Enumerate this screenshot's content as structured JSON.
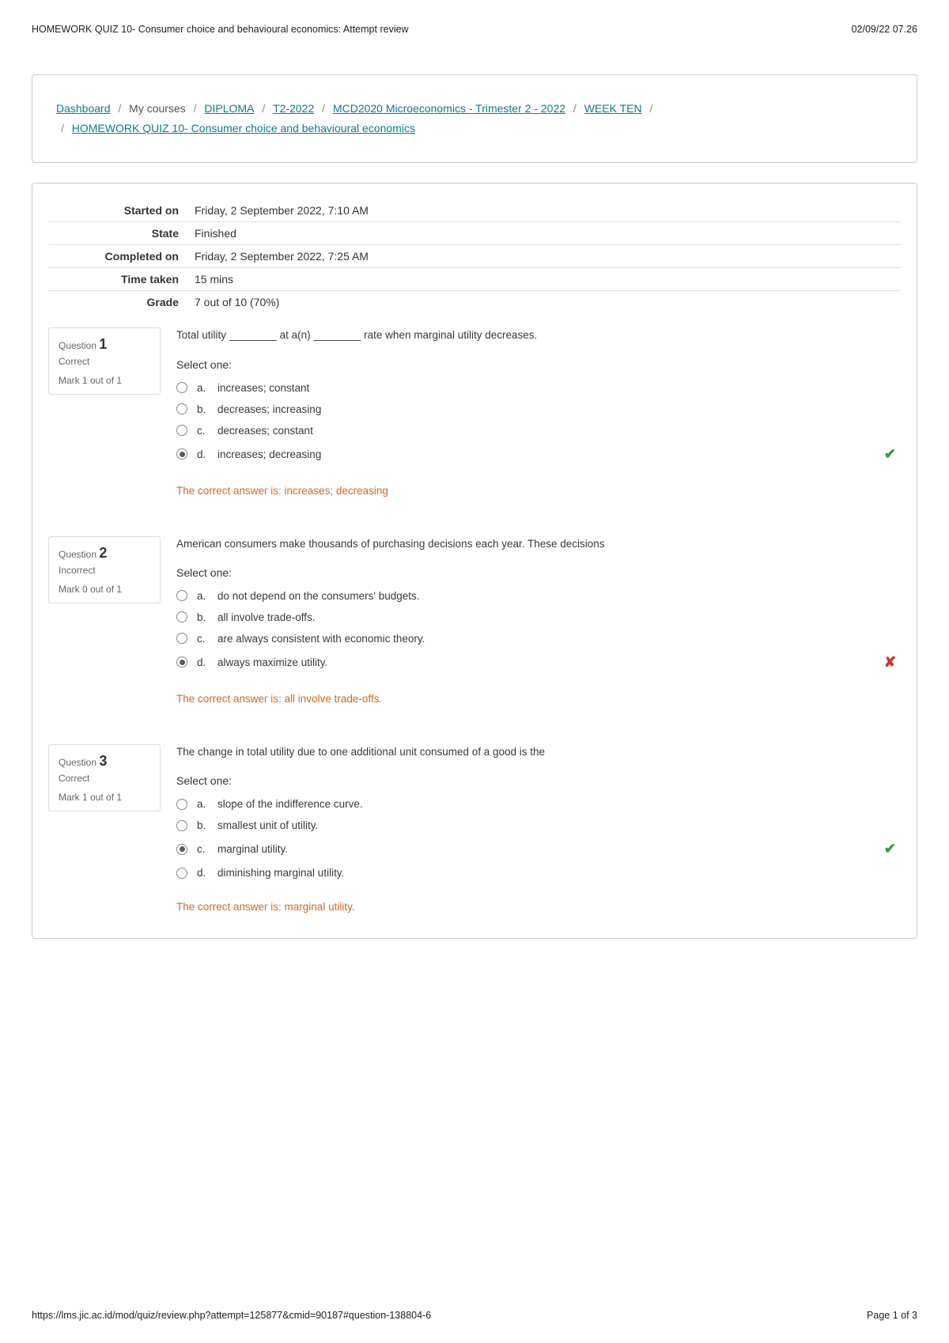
{
  "header": {
    "title": "HOMEWORK QUIZ 10- Consumer choice and behavioural economics: Attempt review",
    "datetime": "02/09/22 07.26"
  },
  "breadcrumb": {
    "items": [
      {
        "label": "Dashboard",
        "link": true
      },
      {
        "label": "My courses",
        "link": false
      },
      {
        "label": "DIPLOMA",
        "link": true
      },
      {
        "label": "T2-2022",
        "link": true
      },
      {
        "label": "MCD2020 Microeconomics - Trimester 2 - 2022",
        "link": true
      },
      {
        "label": "WEEK TEN",
        "link": true
      },
      {
        "label": "HOMEWORK QUIZ 10- Consumer choice and behavioural economics",
        "link": true
      }
    ]
  },
  "summary": [
    {
      "label": "Started on",
      "value": "Friday, 2 September 2022, 7:10 AM"
    },
    {
      "label": "State",
      "value": "Finished"
    },
    {
      "label": "Completed on",
      "value": "Friday, 2 September 2022, 7:25 AM"
    },
    {
      "label": "Time taken",
      "value": "15 mins"
    },
    {
      "label": "Grade",
      "value": "7 out of 10 (70%)"
    }
  ],
  "labels": {
    "question": "Question",
    "select_one": "Select one:",
    "feedback_prefix": "The correct answer is: "
  },
  "questions": [
    {
      "number": "1",
      "status": "Correct",
      "mark": "Mark 1 out of 1",
      "text": "Total utility ________ at a(n) ________ rate when marginal utility decreases.",
      "options": [
        {
          "letter": "a.",
          "text": "increases; constant",
          "selected": false,
          "mark": ""
        },
        {
          "letter": "b.",
          "text": "decreases; increasing",
          "selected": false,
          "mark": ""
        },
        {
          "letter": "c.",
          "text": "decreases; constant",
          "selected": false,
          "mark": ""
        },
        {
          "letter": "d.",
          "text": "increases; decreasing",
          "selected": true,
          "mark": "correct"
        }
      ],
      "feedback": "increases; decreasing"
    },
    {
      "number": "2",
      "status": "Incorrect",
      "mark": "Mark 0 out of 1",
      "text": "American consumers make thousands of purchasing decisions each year. These decisions",
      "options": [
        {
          "letter": "a.",
          "text": "do not depend on the consumers' budgets.",
          "selected": false,
          "mark": ""
        },
        {
          "letter": "b.",
          "text": "all involve trade-offs.",
          "selected": false,
          "mark": ""
        },
        {
          "letter": "c.",
          "text": "are always consistent with economic theory.",
          "selected": false,
          "mark": ""
        },
        {
          "letter": "d.",
          "text": "always maximize utility.",
          "selected": true,
          "mark": "incorrect"
        }
      ],
      "feedback": "all involve trade-offs."
    },
    {
      "number": "3",
      "status": "Correct",
      "mark": "Mark 1 out of 1",
      "text": "The change in total utility due to one additional unit consumed of a good is the",
      "options": [
        {
          "letter": "a.",
          "text": "slope of the indifference curve.",
          "selected": false,
          "mark": ""
        },
        {
          "letter": "b.",
          "text": "smallest unit of utility.",
          "selected": false,
          "mark": ""
        },
        {
          "letter": "c.",
          "text": "marginal utility.",
          "selected": true,
          "mark": "correct"
        },
        {
          "letter": "d.",
          "text": "diminishing marginal utility.",
          "selected": false,
          "mark": ""
        }
      ],
      "feedback": "marginal utility."
    }
  ],
  "footer": {
    "url": "https://lms.jic.ac.id/mod/quiz/review.php?attempt=125877&cmid=90187#question-138804-6",
    "page": "Page 1 of 3"
  }
}
